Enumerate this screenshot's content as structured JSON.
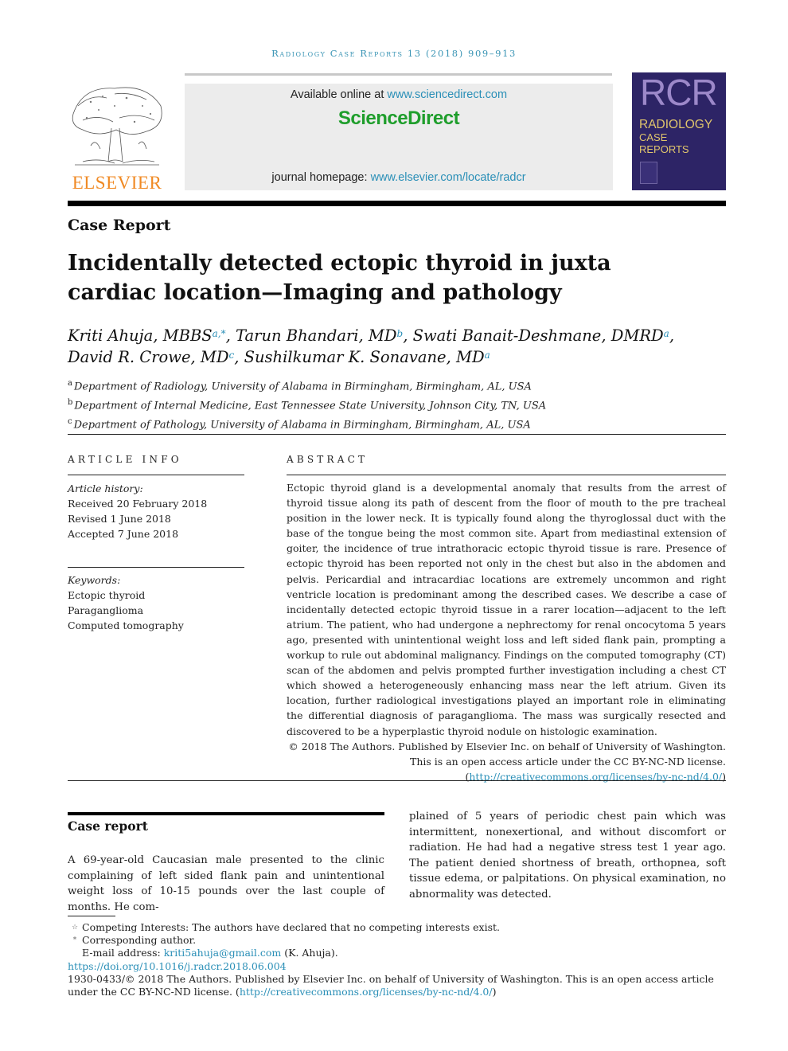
{
  "running_head": "Radiology Case Reports 13 (2018) 909–913",
  "publisher": {
    "logo_word": "ELSEVIER",
    "available_online_prefix": "Available online at ",
    "available_online_link": "www.sciencedirect.com",
    "brand": "ScienceDirect",
    "homepage_prefix": "journal homepage: ",
    "homepage_link": "www.elsevier.com/locate/radcr"
  },
  "journal_cover": {
    "acronym": "RCR",
    "line1": "RADIOLOGY",
    "line2": "CASE",
    "line3": "REPORTS",
    "colors": {
      "background": "#2d2466",
      "acronym": "#9c88c9",
      "title": "#e0c56c"
    }
  },
  "article_type": "Case Report",
  "title": "Incidentally detected ectopic thyroid in juxta cardiac location—Imaging and pathology",
  "authors": [
    {
      "name": "Kriti Ahuja, MBBS",
      "sup": "a,*",
      "sep": ", "
    },
    {
      "name": "Tarun Bhandari, MD",
      "sup": "b",
      "sep": ", "
    },
    {
      "name": "Swati Banait-Deshmane, DMRD",
      "sup": "a",
      "sep": ","
    },
    {
      "name": "David R. Crowe, MD",
      "sup": "c",
      "sep": ", "
    },
    {
      "name": "Sushilkumar K. Sonavane, MD",
      "sup": "a",
      "sep": ""
    }
  ],
  "affiliations": [
    {
      "mark": "a",
      "text": "Department of Radiology, University of Alabama in Birmingham, Birmingham, AL, USA"
    },
    {
      "mark": "b",
      "text": "Department of Internal Medicine, East Tennessee State University, Johnson City, TN, USA"
    },
    {
      "mark": "c",
      "text": "Department of Pathology, University of Alabama in Birmingham, Birmingham, AL, USA"
    }
  ],
  "article_info": {
    "heading": "ARTICLE INFO",
    "history_label": "Article history:",
    "history": [
      "Received 20 February 2018",
      "Revised 1 June 2018",
      "Accepted 7 June 2018"
    ],
    "keywords_label": "Keywords:",
    "keywords": [
      "Ectopic thyroid",
      "Paraganglioma",
      "Computed tomography"
    ]
  },
  "abstract": {
    "heading": "ABSTRACT",
    "text": "Ectopic thyroid gland is a developmental anomaly that results from the arrest of thyroid tissue along its path of descent from the floor of mouth to the pre tracheal position in the lower neck. It is typically found along the thyroglossal duct with the base of the tongue being the most common site. Apart from mediastinal extension of goiter, the incidence of true intrathoracic ectopic thyroid tissue is rare. Presence of ectopic thyroid has been reported not only in the chest but also in the abdomen and pelvis. Pericardial and intracardiac locations are extremely uncommon and right ventricle location is predominant among the described cases. We describe a case of incidentally detected ectopic thyroid tissue in a rarer location—adjacent to the left atrium. The patient, who had undergone a nephrectomy for renal oncocytoma 5 years ago, presented with unintentional weight loss and left sided flank pain, prompting a workup to rule out abdominal malignancy. Findings on the computed tomography (CT) scan of the abdomen and pelvis prompted further investigation including a chest CT which showed a heterogeneously enhancing mass near the left atrium. Given its location, further radiological investigations played an important role in eliminating the differential diagnosis of paraganglioma. The mass was surgically resected and discovered to be a hyperplastic thyroid nodule on histologic examination.",
    "copyright_line1": "© 2018 The Authors. Published by Elsevier Inc. on behalf of University of Washington.",
    "copyright_line2": "This is an open access article under the CC BY-NC-ND license.",
    "license_link": "http://creativecommons.org/licenses/by-nc-nd/4.0/"
  },
  "body": {
    "section_heading": "Case report",
    "left_text": "A 69-year-old Caucasian male presented to the clinic complaining of left sided flank pain and unintentional weight loss of 10-15 pounds over the last couple of months. He com-",
    "right_text": "plained of 5 years of periodic chest pain which was intermittent, nonexertional, and without discomfort or radiation. He had had a negative stress test 1 year ago. The patient denied shortness of breath, orthopnea, soft tissue edema, or palpitations. On physical examination, no abnormality was detected."
  },
  "footnotes": {
    "competing_mark": "☆",
    "competing": "Competing Interests: The authors have declared that no competing interests exist.",
    "corresponding_mark": "*",
    "corresponding": "Corresponding author.",
    "email_label": "E-mail address: ",
    "email": "kriti5ahuja@gmail.com",
    "email_suffix": " (K. Ahuja).",
    "doi": "https://doi.org/10.1016/j.radcr.2018.06.004",
    "license_text": "1930-0433/© 2018 The Authors. Published by Elsevier Inc. on behalf of University of Washington. This is an open access article under the CC BY-NC-ND license. (",
    "license_link": "http://creativecommons.org/licenses/by-nc-nd/4.0/",
    "license_close": ")"
  }
}
